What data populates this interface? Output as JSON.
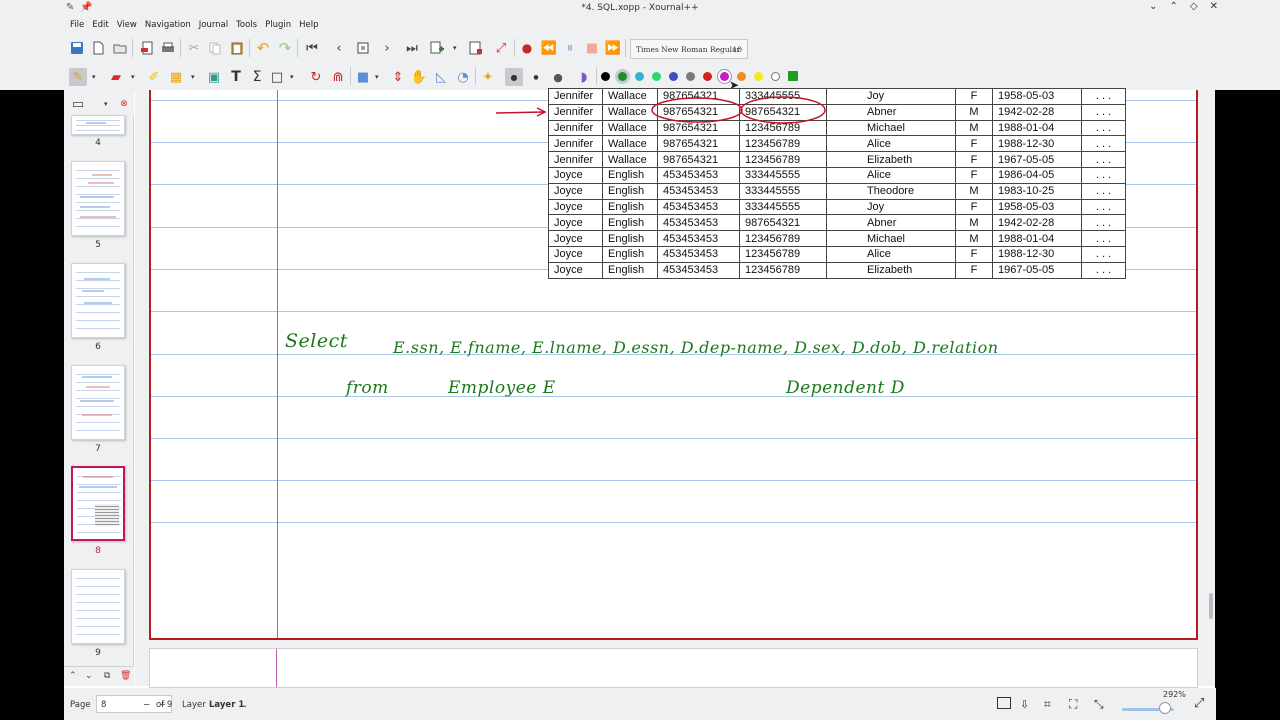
{
  "window": {
    "title": "*4. SQL.xopp - Xournal++"
  },
  "menu": [
    "File",
    "Edit",
    "View",
    "Navigation",
    "Journal",
    "Tools",
    "Plugin",
    "Help"
  ],
  "toolbar": {
    "font_name": "Times New Roman Regular",
    "font_size": "10"
  },
  "colors": {
    "palette": [
      "#000000",
      "#1e8f2e",
      "#30b2d9",
      "#2ed66b",
      "#3a4fbf",
      "#7a7a7a",
      "#d81d1d",
      "#c51ec7",
      "#f08a1e",
      "#f4e81e",
      "#ffffff",
      "#1e9e1e"
    ],
    "ink_green": "#1a7a1a",
    "annotation_red": "#c0142b"
  },
  "sidebar": {
    "pages": [
      {
        "number": "4",
        "selected": false
      },
      {
        "number": "5",
        "selected": false
      },
      {
        "number": "6",
        "selected": false
      },
      {
        "number": "7",
        "selected": false
      },
      {
        "number": "8",
        "selected": true
      },
      {
        "number": "9",
        "selected": false
      }
    ]
  },
  "table": {
    "rows": [
      [
        "Jennifer",
        "Wallace",
        "987654321",
        "333445555",
        "Joy",
        "F",
        "1958-05-03",
        ". . ."
      ],
      [
        "Jennifer",
        "Wallace",
        "987654321",
        "987654321",
        "Abner",
        "M",
        "1942-02-28",
        ". . ."
      ],
      [
        "Jennifer",
        "Wallace",
        "987654321",
        "123456789",
        "Michael",
        "M",
        "1988-01-04",
        ". . ."
      ],
      [
        "Jennifer",
        "Wallace",
        "987654321",
        "123456789",
        "Alice",
        "F",
        "1988-12-30",
        ". . ."
      ],
      [
        "Jennifer",
        "Wallace",
        "987654321",
        "123456789",
        "Elizabeth",
        "F",
        "1967-05-05",
        ". . ."
      ],
      [
        "Joyce",
        "English",
        "453453453",
        "333445555",
        "Alice",
        "F",
        "1986-04-05",
        ". . ."
      ],
      [
        "Joyce",
        "English",
        "453453453",
        "333445555",
        "Theodore",
        "M",
        "1983-10-25",
        ". . ."
      ],
      [
        "Joyce",
        "English",
        "453453453",
        "333445555",
        "Joy",
        "F",
        "1958-05-03",
        ". . ."
      ],
      [
        "Joyce",
        "English",
        "453453453",
        "987654321",
        "Abner",
        "M",
        "1942-02-28",
        ". . ."
      ],
      [
        "Joyce",
        "English",
        "453453453",
        "123456789",
        "Michael",
        "M",
        "1988-01-04",
        ". . ."
      ],
      [
        "Joyce",
        "English",
        "453453453",
        "123456789",
        "Alice",
        "F",
        "1988-12-30",
        ". . ."
      ],
      [
        "Joyce",
        "English",
        "453453453",
        "123456789",
        "Elizabeth",
        "F",
        "1967-05-05",
        ". . ."
      ]
    ]
  },
  "handwriting": {
    "select_kw": "Select",
    "select_cols": "E.ssn, E.fname, E.lname, D.essn, D.dep-name, D.sex, D.dob, D.relation",
    "from_kw": "from",
    "from_table1": "Employee E",
    "from_table2": "Dependent D"
  },
  "statusbar": {
    "page_label": "Page",
    "page_value": "8",
    "page_of": "of 9",
    "layer_label": "Layer",
    "layer_value": "Layer 1",
    "zoom": "292%"
  }
}
